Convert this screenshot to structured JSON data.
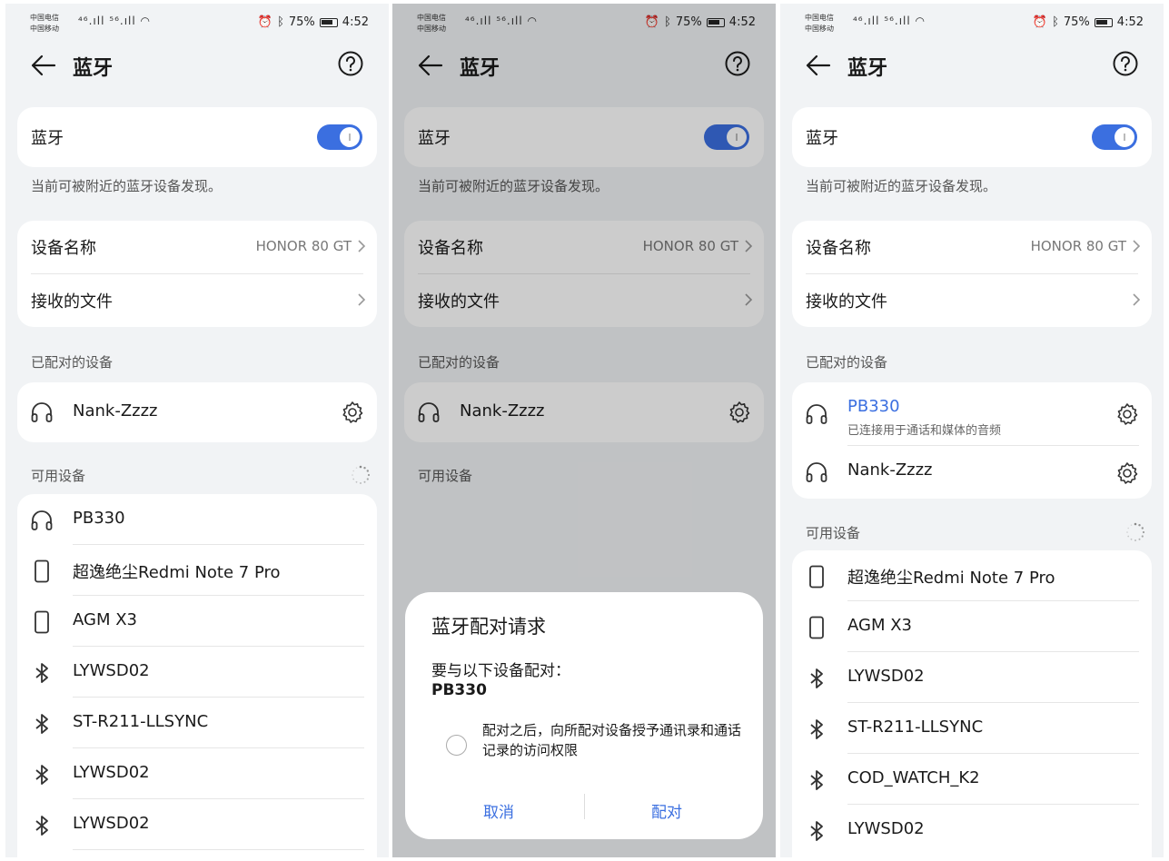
{
  "status": {
    "carrier_1": "中国电信",
    "carrier_2": "中国移动",
    "signal_1": "⁴⁶.ıll",
    "signal_2": "⁵⁶.ıll",
    "battery": "75%",
    "time": "4:52"
  },
  "header": {
    "title": "蓝牙"
  },
  "bluetooth": {
    "label": "蓝牙",
    "enabled": true,
    "discoverable_text": "当前可被附近的蓝牙设备发现。"
  },
  "settings": {
    "device_name_label": "设备名称",
    "device_name_value": "HONOR 80 GT",
    "received_files_label": "接收的文件"
  },
  "sections": {
    "paired": "已配对的设备",
    "available": "可用设备"
  },
  "panel1": {
    "paired": [
      {
        "name": "Nank-Zzzz",
        "icon": "headphones-icon"
      }
    ],
    "available": [
      {
        "name": "PB330",
        "icon": "headphones-icon"
      },
      {
        "name": "超逸绝尘Redmi Note 7 Pro",
        "icon": "phone-icon"
      },
      {
        "name": "AGM X3",
        "icon": "phone-icon"
      },
      {
        "name": "LYWSD02",
        "icon": "bluetooth-icon"
      },
      {
        "name": "ST-R211-LLSYNC",
        "icon": "bluetooth-icon"
      },
      {
        "name": "LYWSD02",
        "icon": "bluetooth-icon"
      },
      {
        "name": "LYWSD02",
        "icon": "bluetooth-icon"
      }
    ]
  },
  "panel2": {
    "paired": [
      {
        "name": "Nank-Zzzz",
        "icon": "headphones-icon"
      }
    ],
    "dialog": {
      "title": "蓝牙配对请求",
      "prompt": "要与以下设备配对：",
      "device": "PB330",
      "permission_text": "配对之后，向所配对设备授予通讯录和通话记录的访问权限",
      "cancel": "取消",
      "confirm": "配对"
    }
  },
  "panel3": {
    "paired": [
      {
        "name": "PB330",
        "status": "已连接用于通话和媒体的音频",
        "icon": "headphones-icon"
      },
      {
        "name": "Nank-Zzzz",
        "icon": "headphones-icon"
      }
    ],
    "available": [
      {
        "name": "超逸绝尘Redmi Note 7 Pro",
        "icon": "phone-icon"
      },
      {
        "name": "AGM X3",
        "icon": "phone-icon"
      },
      {
        "name": "LYWSD02",
        "icon": "bluetooth-icon"
      },
      {
        "name": "ST-R211-LLSYNC",
        "icon": "bluetooth-icon"
      },
      {
        "name": "COD_WATCH_K2",
        "icon": "bluetooth-icon"
      },
      {
        "name": "LYWSD02",
        "icon": "bluetooth-icon"
      }
    ]
  },
  "colors": {
    "accent": "#3b6fe0",
    "background": "#f1f3f5",
    "card": "#ffffff"
  }
}
